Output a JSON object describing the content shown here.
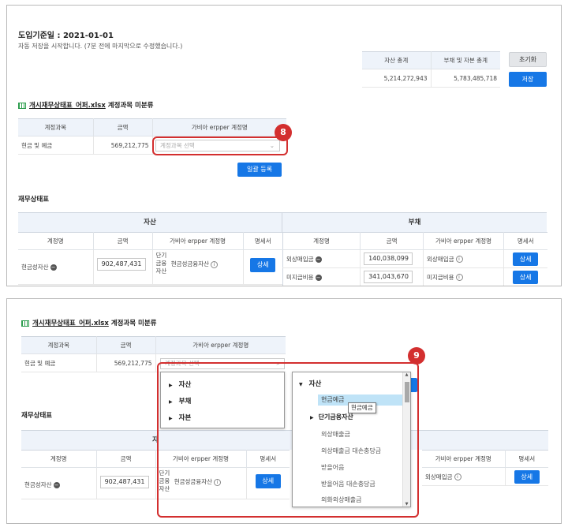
{
  "panel1": {
    "intro_date": "도입기준일 : 2021-01-01",
    "autosave_msg": "자동 저장을 시작합니다. (7분 전에 마지막으로 수정했습니다.)",
    "totals": {
      "headers": [
        "자산 총계",
        "부채 및 자본 총계"
      ],
      "values": [
        "5,214,272,943",
        "5,783,485,718"
      ]
    },
    "reset_label": "초기화",
    "save_label": "저장",
    "file_name": "개시재무상태표_어퍼.xlsx",
    "unclassified_label": " 계정과목 미분류",
    "unclassified_headers": [
      "계정과목",
      "금액",
      "가비아 erpper 계정명"
    ],
    "unclassified_row": {
      "account": "현금 및 예금",
      "amount": "569,212,775",
      "select_placeholder": "계정과목 선택"
    },
    "bulk_register_label": "일괄 등록",
    "step_badge": "8",
    "fs_title": "재무상태표",
    "asset_title": "자산",
    "liab_title": "부채",
    "asset_headers": [
      "계정명",
      "금액",
      "가비아 erpper 계정명",
      "명세서"
    ],
    "liab_headers": [
      "계정명",
      "금액",
      "가비아 erpper 계정명",
      "명세서"
    ],
    "asset_rows": [
      {
        "name": "현금성자산",
        "amount": "902,487,431",
        "group": [
          "단기",
          "금융",
          "자산"
        ],
        "mapped": "현금성금융자산",
        "detail": "상세"
      }
    ],
    "liab_rows": [
      {
        "name": "외상매입금",
        "amount": "140,038,099",
        "mapped": "외상매입금",
        "detail": "상세"
      },
      {
        "name": "미지급비용",
        "amount": "341,043,670",
        "mapped": "미지급비용",
        "detail": "상세"
      }
    ]
  },
  "panel2": {
    "file_name": "개시재무상태표_어퍼.xlsx",
    "unclassified_label": " 계정과목 미분류",
    "unclassified_headers": [
      "계정과목",
      "금액",
      "가비아 erpper 계정명"
    ],
    "unclassified_row": {
      "account": "현금 및 예금",
      "amount": "569,212,775",
      "select_placeholder": "계정과목 선택"
    },
    "step_badge": "9",
    "fs_title": "재무상태표",
    "asset_title_partial": "자",
    "liab_title_partial": "채",
    "asset_headers": [
      "계정명",
      "금액",
      "가비아 erpper 계정명",
      "명세서"
    ],
    "liab_headers": [
      "가비아 erpper 계정명",
      "명세서"
    ],
    "asset_row": {
      "name": "현금성자산",
      "amount": "902,487,431",
      "group": [
        "단기",
        "금융",
        "자산"
      ],
      "mapped": "현금성금융자산",
      "detail": "상세"
    },
    "liab_row": {
      "mapped": "외상매입금",
      "detail": "상세"
    },
    "tree_left": [
      "자산",
      "부채",
      "자본"
    ],
    "tree_right_root": "자산",
    "tree_right_options": [
      "현금예금",
      "단기금융자산",
      "외상매출금",
      "외상매출금 대손충당금",
      "받을어음",
      "받을어음 대손충당금",
      "외화외상매출금"
    ],
    "tooltip": "현금예금"
  }
}
